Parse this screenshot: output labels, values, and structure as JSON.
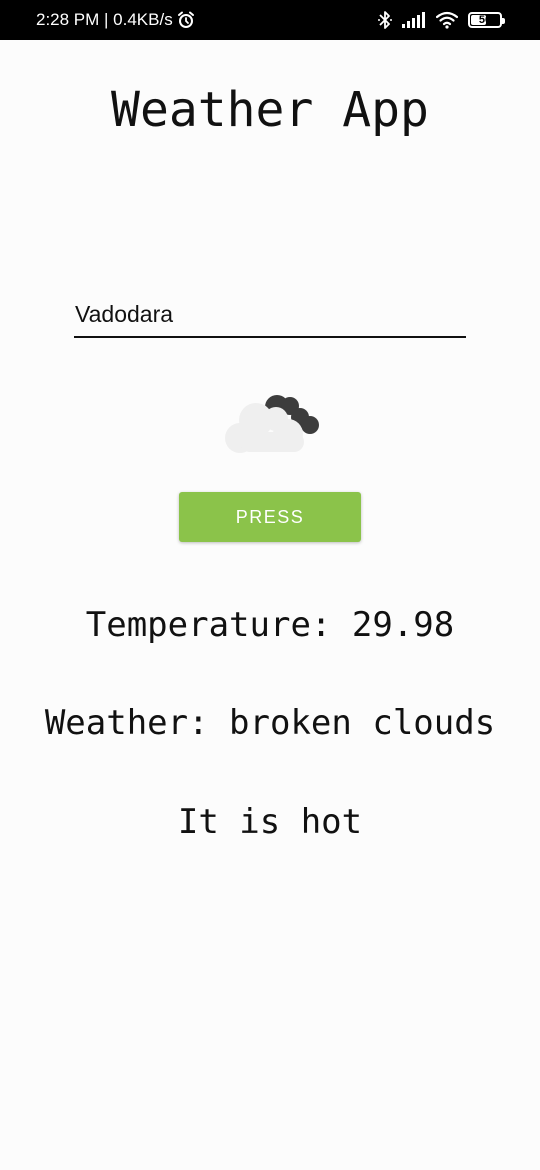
{
  "status_bar": {
    "time_and_speed": "2:28 PM | 0.4KB/s",
    "battery_level": "56",
    "battery_fraction": 0.56,
    "icons": [
      "alarm-icon",
      "bluetooth-icon",
      "signal-icon",
      "wifi-icon",
      "battery-icon"
    ]
  },
  "app": {
    "title": "Weather App",
    "city_input": {
      "value": "Vadodara"
    },
    "weather_icon": "cloud-icon",
    "press_button_label": "PRESS",
    "temperature_text": "Temperature: 29.98",
    "weather_text": "Weather: broken clouds",
    "remark_text": "It is hot"
  },
  "colors": {
    "button": "#8bc34a",
    "status_bar": "#000000",
    "background": "#fcfcfc"
  }
}
